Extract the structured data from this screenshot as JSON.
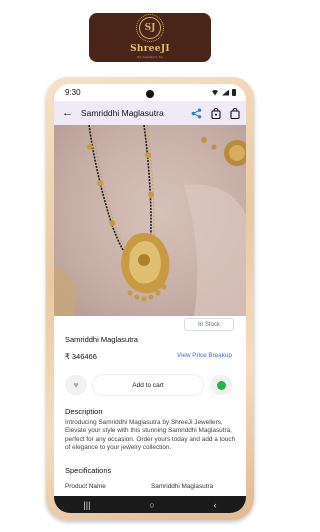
{
  "brand": {
    "name": "ShreeJI",
    "monogram": "SJ",
    "tagline": "SJ Jewellers SJ"
  },
  "status_bar": {
    "time": "9:30"
  },
  "app_bar": {
    "title": "Samriddhi Maglasutra"
  },
  "product": {
    "stock_status": "In Stock",
    "name": "Samriddhi Maglasutra",
    "price": "₹ 346466",
    "price_breakup_link": "View Price Breakup",
    "add_to_cart_label": "Add to cart"
  },
  "description": {
    "heading": "Description",
    "text": "Introducing Samriddhi Maglasutra by ShreeJi Jewellers. Elevate your style with this stunning Samriddhi Maglasutra, perfect for any occasion. Order yours today and add a touch of elegance to your jewelry collection."
  },
  "specifications": {
    "heading": "Specifications",
    "rows": [
      {
        "key": "Product Name",
        "value": "Samriddhi Maglasutra"
      }
    ]
  },
  "nav": {
    "recents": "|||",
    "home": "○",
    "back": "‹"
  },
  "colors": {
    "brand_brown": "#4a2418",
    "gold": "#d8b06a",
    "appbar": "#efeaf6",
    "link": "#3a6fd0",
    "share_blue": "#2f7fd8",
    "whatsapp": "#25b34a"
  }
}
